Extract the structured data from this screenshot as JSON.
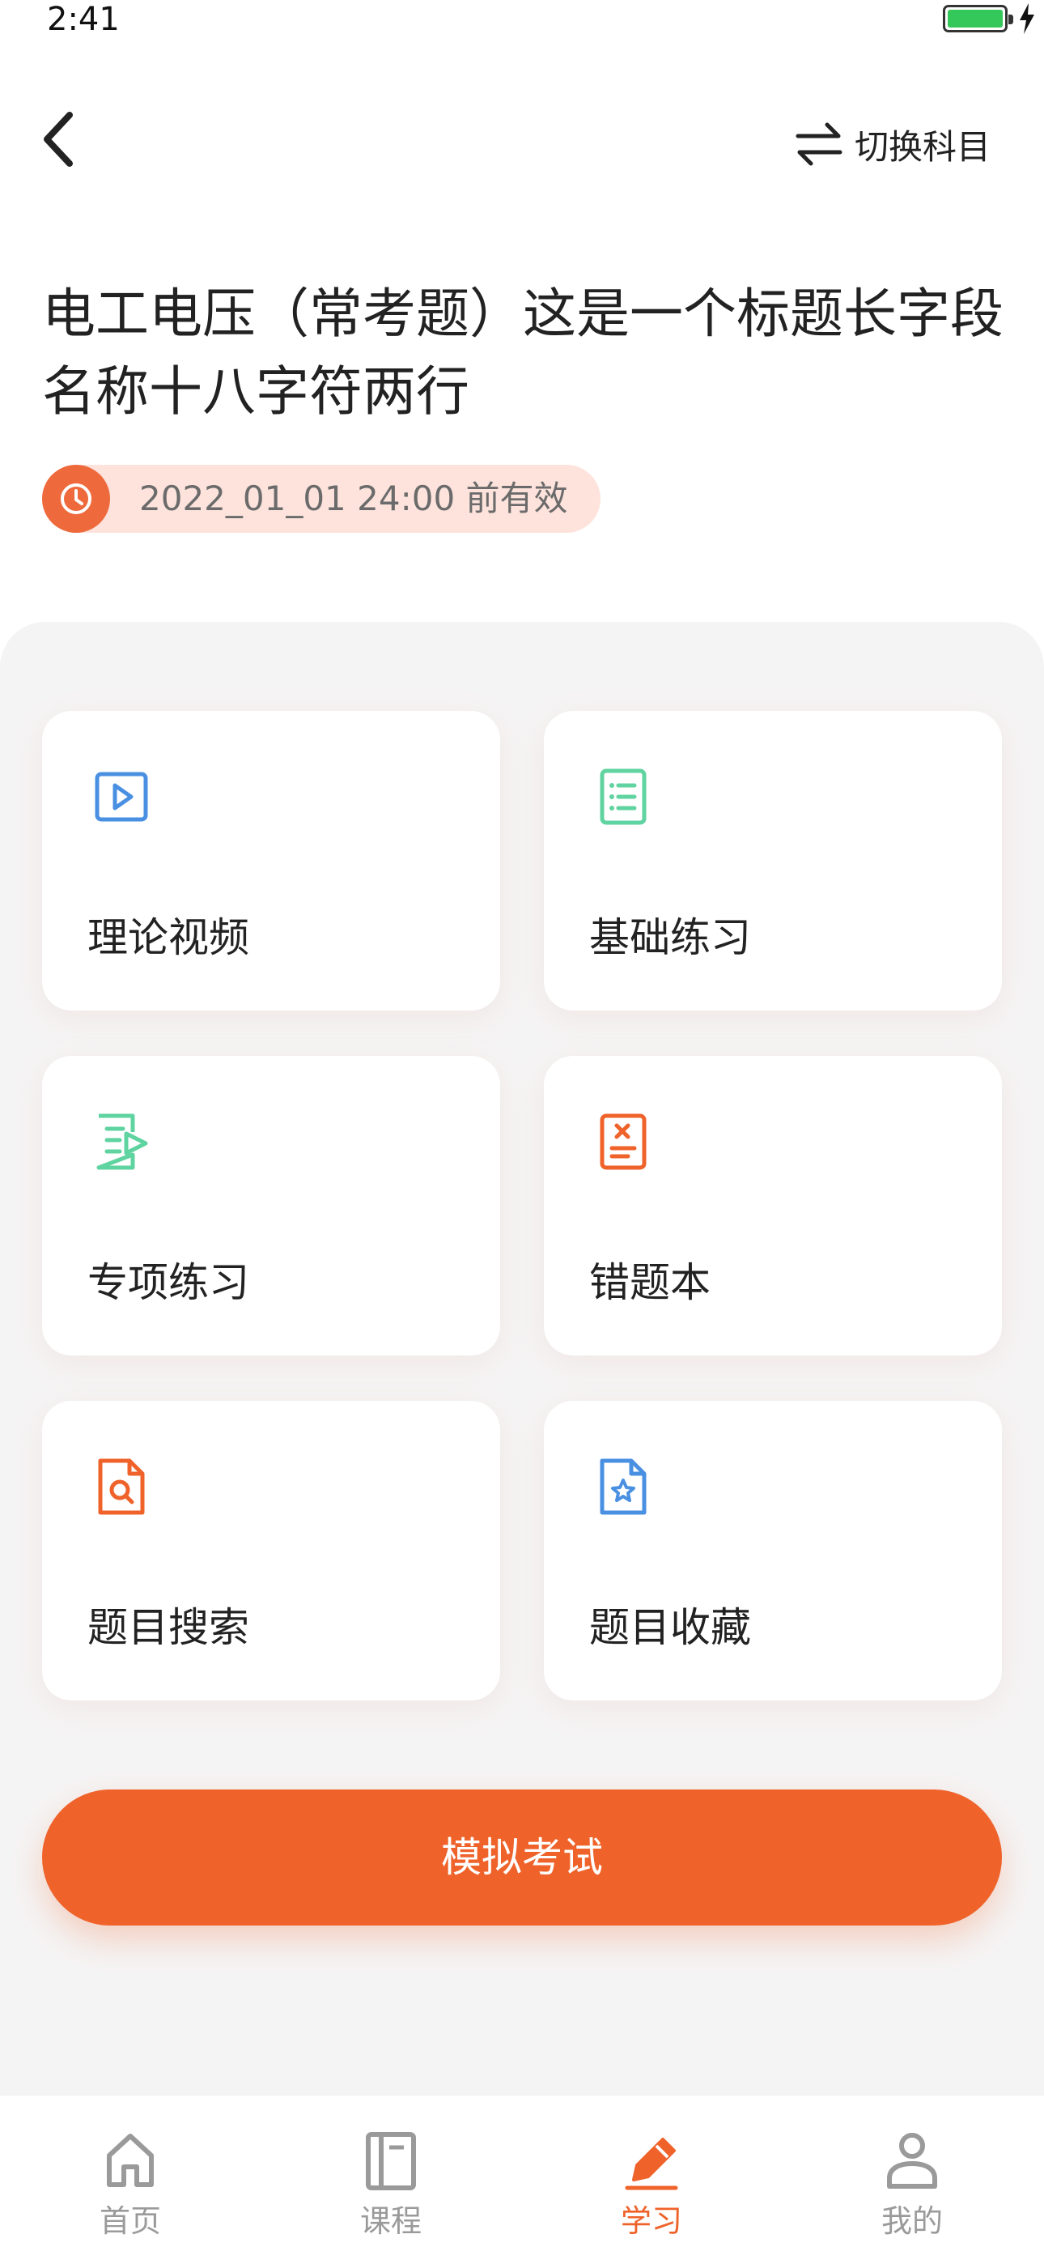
{
  "status_bar": {
    "time": "2:41",
    "battery_level": 1.0
  },
  "header": {
    "switch_label": "切换科目"
  },
  "title": "电工电压（常考题）这是一个标题长字段名称十八字符两行",
  "validity_text": "2022_01_01  24:00 前有效",
  "cards": [
    {
      "label": "理论视频",
      "icon": "video-play-icon",
      "color": "#4a90e2"
    },
    {
      "label": "基础练习",
      "icon": "list-document-icon",
      "color": "#5fd3a0"
    },
    {
      "label": "专项练习",
      "icon": "special-practice-icon",
      "color": "#5fd3a0"
    },
    {
      "label": "错题本",
      "icon": "wrong-answer-book-icon",
      "color": "#ef632b"
    },
    {
      "label": "题目搜索",
      "icon": "document-search-icon",
      "color": "#ef632b"
    },
    {
      "label": "题目收藏",
      "icon": "document-star-icon",
      "color": "#4a90e2"
    }
  ],
  "exam_button": "模拟考试",
  "tabs": [
    {
      "label": "首页",
      "icon": "home-icon",
      "active": false
    },
    {
      "label": "课程",
      "icon": "course-book-icon",
      "active": false
    },
    {
      "label": "学习",
      "icon": "pencil-icon",
      "active": true
    },
    {
      "label": "我的",
      "icon": "user-icon",
      "active": false
    }
  ],
  "colors": {
    "accent": "#ef632b",
    "panel_bg": "#f5f4f4",
    "validity_bg": "#fde3dc",
    "inactive_tab": "#9a9a9a"
  }
}
